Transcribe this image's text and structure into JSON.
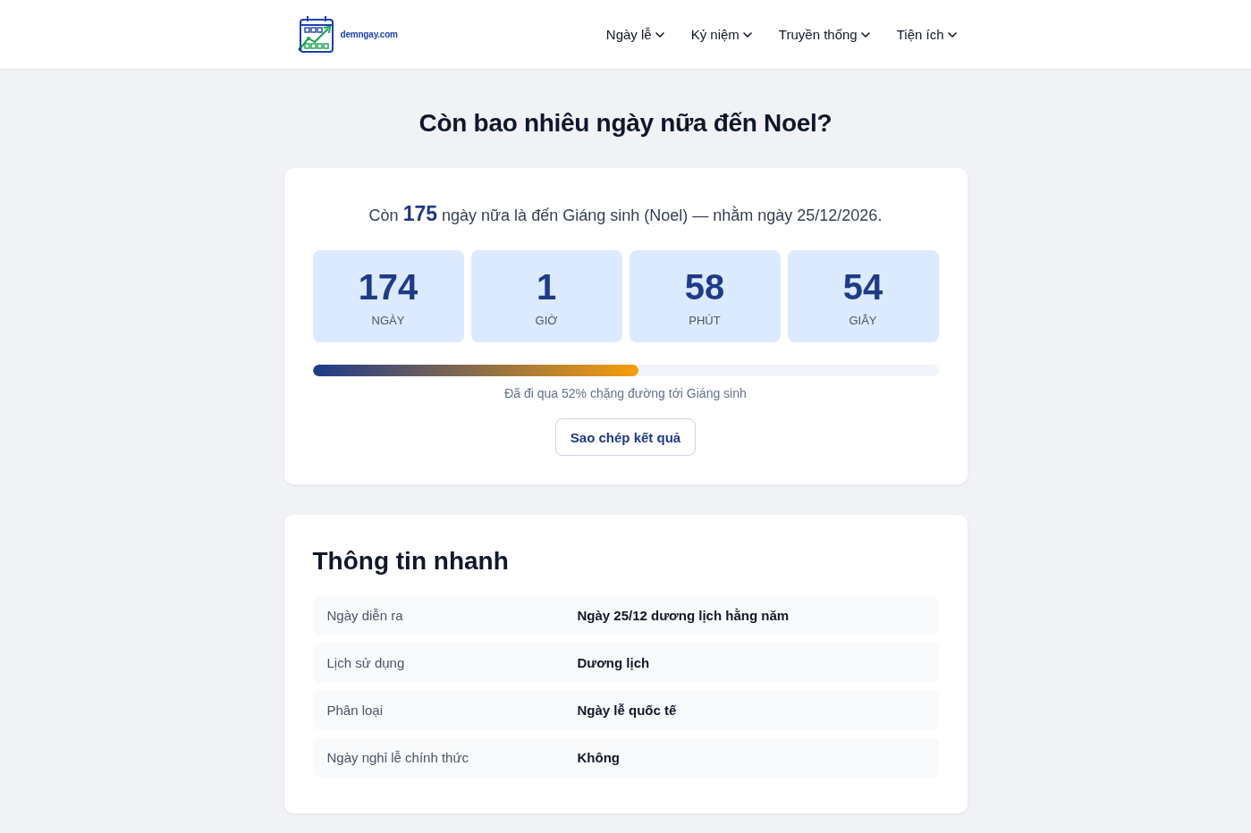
{
  "header": {
    "logo_text": "demngay.com",
    "nav": [
      {
        "label": "Ngày lễ"
      },
      {
        "label": "Kỷ niệm"
      },
      {
        "label": "Truyền thống"
      },
      {
        "label": "Tiện ích"
      }
    ]
  },
  "page_title": "Còn bao nhiêu ngày nữa đến Noel?",
  "countdown_card": {
    "summary": "Còn **175** ngày nữa là đến Giáng sinh (Noel) — nhằm ngày 25/12/2026.",
    "units": [
      {
        "value": "174",
        "label": "NGÀY"
      },
      {
        "value": "1",
        "label": "GIỜ"
      },
      {
        "value": "58",
        "label": "PHÚT"
      },
      {
        "value": "54",
        "label": "GIÂY"
      }
    ],
    "progress": {
      "level": 0.52,
      "caption": "Đã đi qua 52% chặng đường tới Giáng sinh"
    },
    "copy_button": "Sao chép kết quả"
  },
  "quick_info": {
    "title": "Thông tin nhanh",
    "rows": [
      {
        "label": "Ngày diễn ra",
        "value": "Ngày 25/12 dương lịch hằng năm"
      },
      {
        "label": "Lịch sử dụng",
        "value": "Dương lịch"
      },
      {
        "label": "Phân loại",
        "value": "Ngày lễ quốc tế"
      },
      {
        "label": "Ngày nghỉ lễ chính thức",
        "value": "Không"
      }
    ]
  }
}
